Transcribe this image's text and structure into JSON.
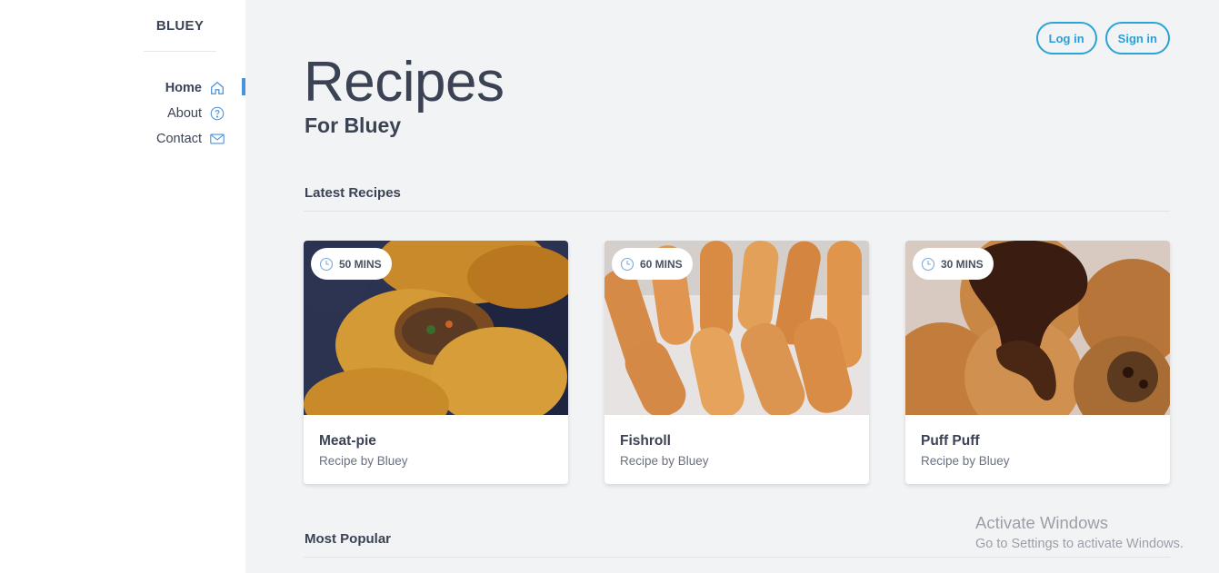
{
  "brand": "BLUEY",
  "nav": [
    {
      "label": "Home",
      "icon": "home-icon"
    },
    {
      "label": "About",
      "icon": "question-icon"
    },
    {
      "label": "Contact",
      "icon": "mail-icon"
    }
  ],
  "auth": {
    "login_label": "Log in",
    "signin_label": "Sign in"
  },
  "header": {
    "title": "Recipes",
    "subtitle": "For Bluey"
  },
  "sections": {
    "latest": "Latest Recipes",
    "popular": "Most Popular"
  },
  "recipes": [
    {
      "name": "Meat-pie",
      "by": "Recipe by Bluey",
      "time": "50 MINS",
      "image": "meat-pie-photo"
    },
    {
      "name": "Fishroll",
      "by": "Recipe by Bluey",
      "time": "60 MINS",
      "image": "fishroll-photo"
    },
    {
      "name": "Puff Puff",
      "by": "Recipe by Bluey",
      "time": "30 MINS",
      "image": "puff-puff-photo"
    }
  ],
  "watermark": {
    "line1": "Activate Windows",
    "line2": "Go to Settings to activate Windows."
  },
  "colors": {
    "accent": "#2aa3d9",
    "active_bar": "#4a90e2",
    "text": "#3a4254",
    "background": "#f2f3f5"
  }
}
